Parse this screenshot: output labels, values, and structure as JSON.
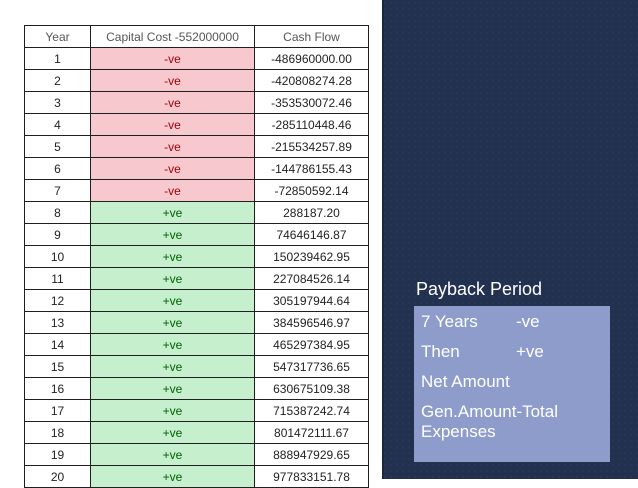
{
  "table": {
    "headers": [
      "Year",
      "Capital Cost -552000000",
      "Cash Flow"
    ],
    "rows": [
      {
        "year": "1",
        "sign": "-ve",
        "cash_flow": "-486960000.00"
      },
      {
        "year": "2",
        "sign": "-ve",
        "cash_flow": "-420808274.28"
      },
      {
        "year": "3",
        "sign": "-ve",
        "cash_flow": "-353530072.46"
      },
      {
        "year": "4",
        "sign": "-ve",
        "cash_flow": "-285110448.46"
      },
      {
        "year": "5",
        "sign": "-ve",
        "cash_flow": "-215534257.89"
      },
      {
        "year": "6",
        "sign": "-ve",
        "cash_flow": "-144786155.43"
      },
      {
        "year": "7",
        "sign": "-ve",
        "cash_flow": "-72850592.14"
      },
      {
        "year": "8",
        "sign": "+ve",
        "cash_flow": "288187.20"
      },
      {
        "year": "9",
        "sign": "+ve",
        "cash_flow": "74646146.87"
      },
      {
        "year": "10",
        "sign": "+ve",
        "cash_flow": "150239462.95"
      },
      {
        "year": "11",
        "sign": "+ve",
        "cash_flow": "227084526.14"
      },
      {
        "year": "12",
        "sign": "+ve",
        "cash_flow": "305197944.64"
      },
      {
        "year": "13",
        "sign": "+ve",
        "cash_flow": "384596546.97"
      },
      {
        "year": "14",
        "sign": "+ve",
        "cash_flow": "465297384.95"
      },
      {
        "year": "15",
        "sign": "+ve",
        "cash_flow": "547317736.65"
      },
      {
        "year": "16",
        "sign": "+ve",
        "cash_flow": "630675109.38"
      },
      {
        "year": "17",
        "sign": "+ve",
        "cash_flow": "715387242.74"
      },
      {
        "year": "18",
        "sign": "+ve",
        "cash_flow": "801472111.67"
      },
      {
        "year": "19",
        "sign": "+ve",
        "cash_flow": "888947929.65"
      },
      {
        "year": "20",
        "sign": "+ve",
        "cash_flow": "977833151.78"
      }
    ]
  },
  "payback": {
    "title": "Payback Period",
    "line1_left": "7 Years",
    "line1_right": "-ve",
    "line2_left": "Then",
    "line2_right": "+ve",
    "line3": "Net Amount",
    "line4": "Gen.Amount-Total Expenses"
  },
  "colors": {
    "panel_bg": "#223150",
    "box_bg": "#8e9ccb",
    "negative_fill": "#f7c9cf",
    "negative_text": "#9c0006",
    "positive_fill": "#c6efce",
    "positive_text": "#006100"
  }
}
